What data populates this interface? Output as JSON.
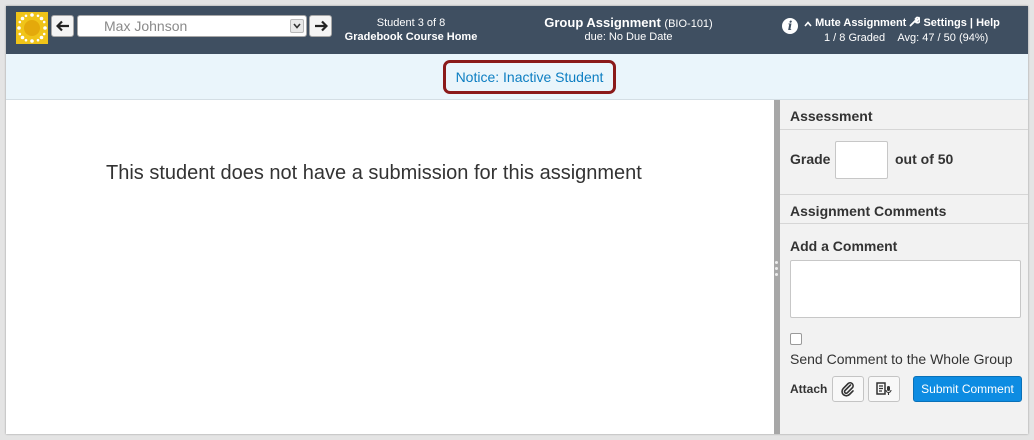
{
  "header": {
    "student_name": "Max Johnson",
    "student_count": "Student 3 of 8",
    "gradebook_link": "Gradebook Course Home",
    "assignment_title": "Group Assignment",
    "course_code": "(BIO-101)",
    "due_date": "due: No Due Date",
    "info_icon_glyph": "i",
    "mute_label": "Mute Assignment",
    "settings_label": "Settings",
    "separator": "|",
    "help_label": "Help",
    "graded_count": "1 / 8 Graded",
    "average": "Avg: 47 / 50 (94%)"
  },
  "notice": {
    "text": "Notice: Inactive Student"
  },
  "main": {
    "no_submission_text": "This student does not have a submission for this assignment"
  },
  "panel": {
    "assessment_header": "Assessment",
    "grade_label": "Grade",
    "grade_value": "",
    "out_of_label": "out of 50",
    "comments_header": "Assignment Comments",
    "add_comment_label": "Add a Comment",
    "send_to_group_label": "Send Comment to the Whole Group",
    "send_to_group_checked": false,
    "attach_label": "Attach",
    "submit_label": "Submit Comment"
  },
  "icons": {
    "logo": "canvas-logo-icon",
    "prev": "arrow-left-icon",
    "next": "arrow-right-icon",
    "caret": "chevron-down-icon",
    "info": "info-icon",
    "mute": "chevron-up-icon",
    "settings": "wrench-icon",
    "attach_file": "paperclip-icon",
    "media": "media-comment-icon"
  },
  "colors": {
    "header_bg": "#3f4f61",
    "notice_bg": "#eaf5fb",
    "notice_link": "#0d7ec2",
    "highlight_border": "#8b1a1a",
    "submit_bg": "#0d8ce2",
    "logo": "#f0c419"
  }
}
